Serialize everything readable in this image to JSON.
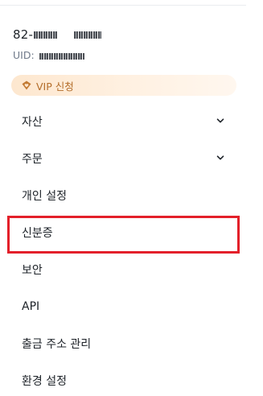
{
  "profile": {
    "name": "82-",
    "uid_label": "UID:"
  },
  "vip": {
    "label": "VIP 신청",
    "accent_color": "#b46d2a"
  },
  "menu": {
    "items": [
      {
        "label": "자산",
        "expandable": true
      },
      {
        "label": "주문",
        "expandable": true
      },
      {
        "label": "개인 설정",
        "expandable": false
      },
      {
        "label": "신분증",
        "expandable": false
      },
      {
        "label": "보안",
        "expandable": false
      },
      {
        "label": "API",
        "expandable": false
      },
      {
        "label": "출금 주소 관리",
        "expandable": false
      },
      {
        "label": "환경 설정",
        "expandable": false
      }
    ]
  },
  "highlight": {
    "target": "신분증",
    "color": "#e3202a"
  }
}
